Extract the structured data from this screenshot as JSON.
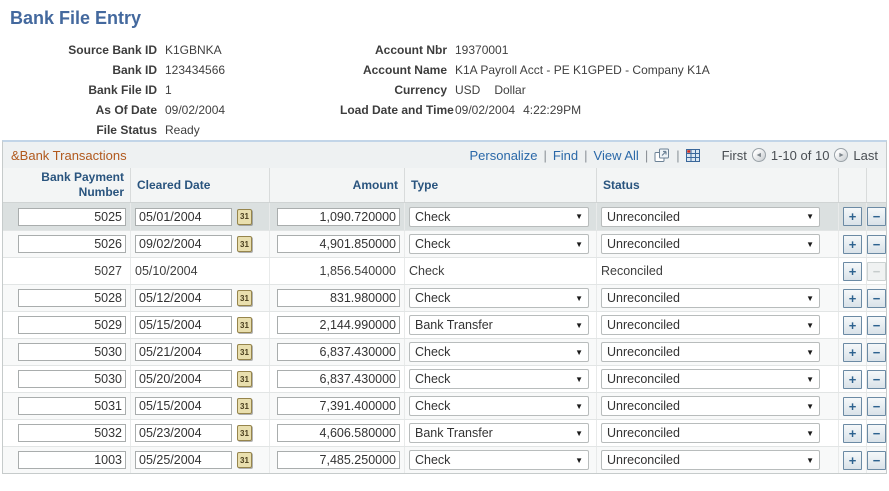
{
  "page_title": "Bank File Entry",
  "header_fields": {
    "left": [
      {
        "label": "Source Bank ID",
        "value": "K1GBNKA"
      },
      {
        "label": "Bank ID",
        "value": "123434566"
      },
      {
        "label": "Bank File ID",
        "value": "1"
      },
      {
        "label": "As Of Date",
        "value": "09/02/2004"
      },
      {
        "label": "File Status",
        "value": "Ready"
      }
    ],
    "right": [
      {
        "label": "Account Nbr",
        "value": "19370001"
      },
      {
        "label": "Account Name",
        "value": "K1A Payroll Acct - PE K1GPED - Company K1A"
      },
      {
        "label": "Currency",
        "value": "USD",
        "value2": "Dollar"
      },
      {
        "label": "Load Date and Time",
        "value": "09/02/2004",
        "value2": "4:22:29PM"
      }
    ]
  },
  "grid": {
    "title": "&Bank Transactions",
    "toolbar": {
      "personalize": "Personalize",
      "find": "Find",
      "view_all": "View All",
      "sep": "|",
      "zoom_icon": "zoom-grid-icon",
      "download_icon": "download-to-excel-icon"
    },
    "pagination": {
      "first": "First",
      "range": "1-10 of 10",
      "last": "Last"
    },
    "icons": {
      "calendar": "31",
      "caret": "▼",
      "plus": "+",
      "minus": "−",
      "prev": "◄",
      "next": "►"
    },
    "columns": [
      "Bank Payment Number",
      "Cleared Date",
      "Amount",
      "Type",
      "Status"
    ],
    "rows": [
      {
        "payment_number": "5025",
        "cleared_date": "05/01/2004",
        "amount": "1,090.720000",
        "type": "Check",
        "status": "Unreconciled",
        "editable": true,
        "selected": true
      },
      {
        "payment_number": "5026",
        "cleared_date": "09/02/2004",
        "amount": "4,901.850000",
        "type": "Check",
        "status": "Unreconciled",
        "editable": true,
        "selected": false
      },
      {
        "payment_number": "5027",
        "cleared_date": "05/10/2004",
        "amount": "1,856.540000",
        "type": "Check",
        "status": "Reconciled",
        "editable": false,
        "selected": false
      },
      {
        "payment_number": "5028",
        "cleared_date": "05/12/2004",
        "amount": "831.980000",
        "type": "Check",
        "status": "Unreconciled",
        "editable": true,
        "selected": false
      },
      {
        "payment_number": "5029",
        "cleared_date": "05/15/2004",
        "amount": "2,144.990000",
        "type": "Bank Transfer",
        "status": "Unreconciled",
        "editable": true,
        "selected": false
      },
      {
        "payment_number": "5030",
        "cleared_date": "05/21/2004",
        "amount": "6,837.430000",
        "type": "Check",
        "status": "Unreconciled",
        "editable": true,
        "selected": false
      },
      {
        "payment_number": "5030",
        "cleared_date": "05/20/2004",
        "amount": "6,837.430000",
        "type": "Check",
        "status": "Unreconciled",
        "editable": true,
        "selected": false
      },
      {
        "payment_number": "5031",
        "cleared_date": "05/15/2004",
        "amount": "7,391.400000",
        "type": "Check",
        "status": "Unreconciled",
        "editable": true,
        "selected": false
      },
      {
        "payment_number": "5032",
        "cleared_date": "05/23/2004",
        "amount": "4,606.580000",
        "type": "Bank Transfer",
        "status": "Unreconciled",
        "editable": true,
        "selected": false
      },
      {
        "payment_number": "1003",
        "cleared_date": "05/25/2004",
        "amount": "7,485.250000",
        "type": "Check",
        "status": "Unreconciled",
        "editable": true,
        "selected": false
      }
    ]
  },
  "colors": {
    "title": "#44699e",
    "grid_title": "#b1591d",
    "link": "#2a68a8",
    "header_text": "#29547e",
    "selected_row": "#dbe0e0"
  }
}
